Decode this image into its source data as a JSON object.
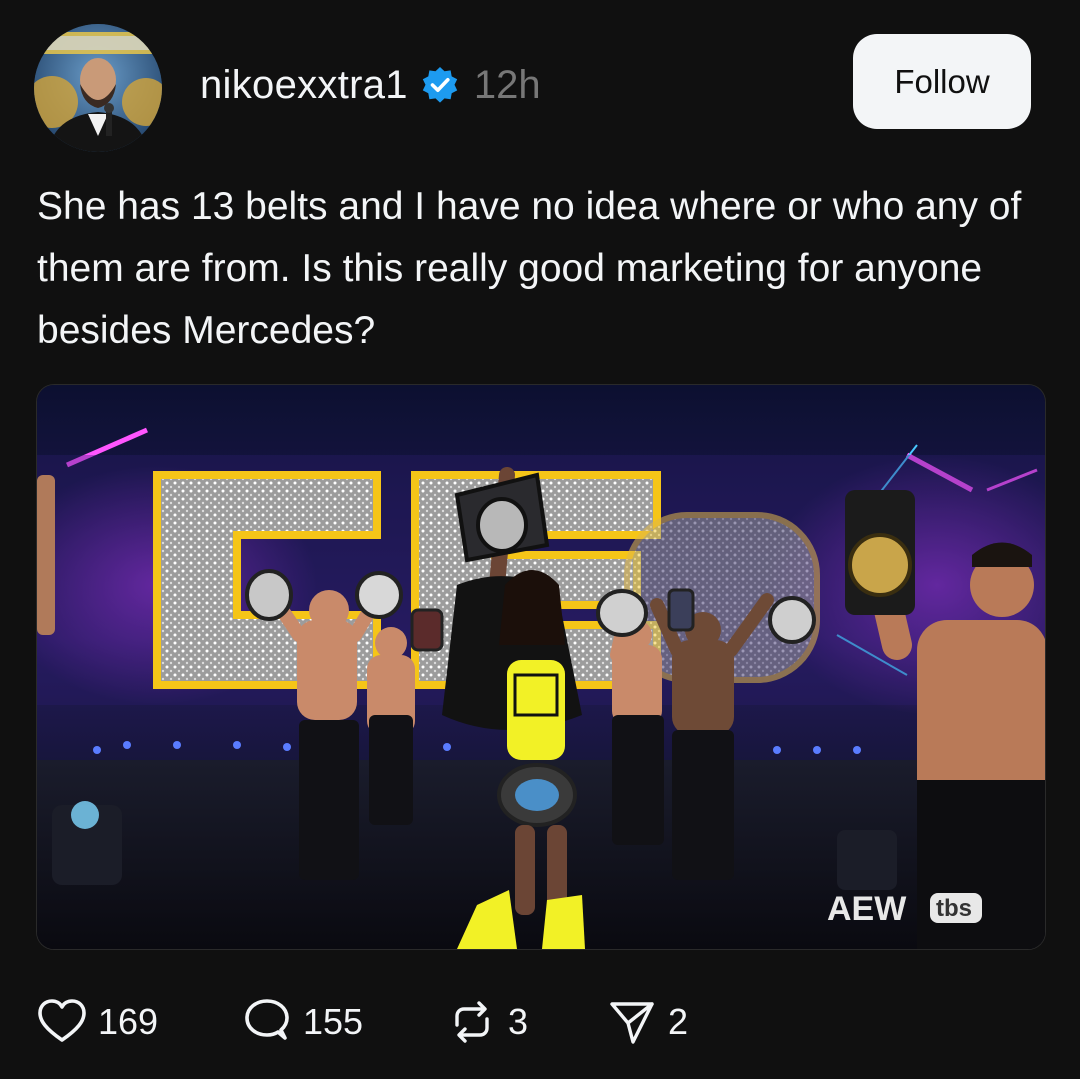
{
  "post": {
    "author": {
      "username": "nikoexxtra1",
      "verified": true,
      "avatar_alt": "profile photo"
    },
    "timestamp": "12h",
    "follow_label": "Follow",
    "text": "She has 13 belts and I have no idea where or who any of them are from. Is this really good marketing for anyone besides Mercedes?",
    "media": {
      "type": "photo",
      "watermark_left": "AEW",
      "watermark_right": "tbs"
    },
    "actions": {
      "likes": "169",
      "replies": "155",
      "reposts": "3",
      "shares": "2"
    }
  },
  "colors": {
    "background": "#101010",
    "text": "#f3f5f7",
    "muted": "#777777",
    "verified": "#1d9bf0",
    "follow_bg": "#f3f5f7"
  },
  "icons": {
    "verified": "verified-badge-icon",
    "like": "heart-icon",
    "reply": "speech-bubble-icon",
    "repost": "repost-arrows-icon",
    "share": "paper-plane-icon"
  }
}
